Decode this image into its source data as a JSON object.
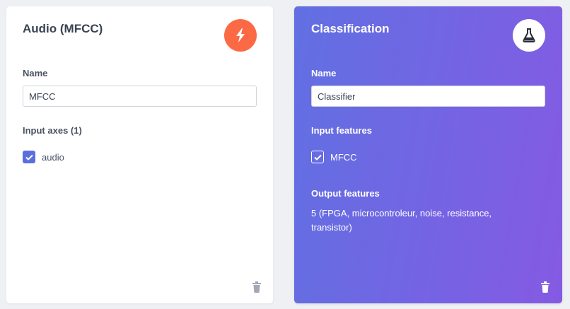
{
  "left_card": {
    "title": "Audio (MFCC)",
    "icon": "lightning-bolt-icon",
    "accent_color": "#fb6a44",
    "name_label": "Name",
    "name_value": "MFCC",
    "axes_label": "Input axes (1)",
    "axes": [
      {
        "label": "audio",
        "checked": true
      }
    ]
  },
  "right_card": {
    "title": "Classification",
    "icon": "flask-icon",
    "gradient_colors": [
      "#6170e2",
      "#855ae3"
    ],
    "name_label": "Name",
    "name_value": "Classifier",
    "features_label": "Input features",
    "features": [
      {
        "label": "MFCC",
        "checked": true
      }
    ],
    "output_label": "Output features",
    "output_value": "5 (FPGA, microcontroleur, noise, resistance, transistor)"
  }
}
